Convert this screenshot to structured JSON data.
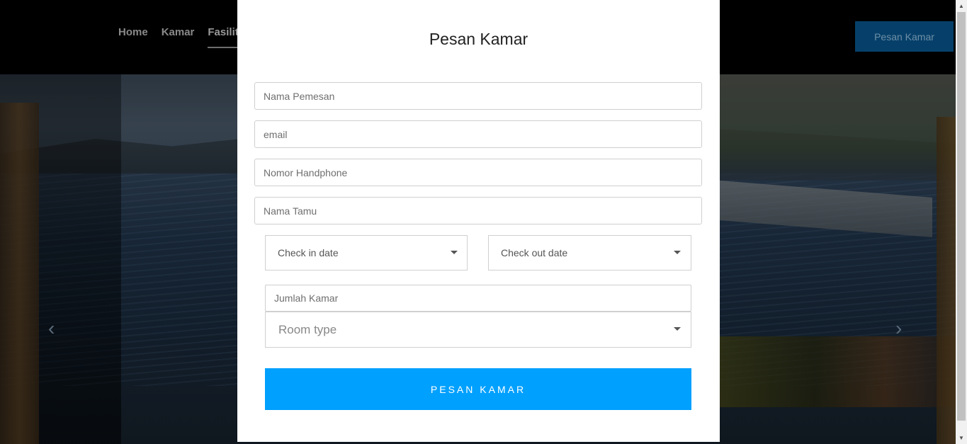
{
  "nav": {
    "links": [
      {
        "label": "Home"
      },
      {
        "label": "Kamar"
      },
      {
        "label": "Fasilit"
      }
    ],
    "cta_label": "Pesan Kamar"
  },
  "hero": {
    "prev_arrow": "‹",
    "next_arrow": "›"
  },
  "modal": {
    "title": "Pesan Kamar",
    "fields": {
      "nama_pemesan": {
        "placeholder": "Nama Pemesan",
        "value": ""
      },
      "email": {
        "placeholder": "email",
        "value": ""
      },
      "nomor_handphone": {
        "placeholder": "Nomor Handphone",
        "value": ""
      },
      "nama_tamu": {
        "placeholder": "Nama Tamu",
        "value": ""
      },
      "jumlah_kamar": {
        "placeholder": "Jumlah Kamar",
        "value": ""
      }
    },
    "check_in": {
      "label": "Check in date",
      "icon": "chevron-down-icon"
    },
    "check_out": {
      "label": "Check out date",
      "icon": "chevron-down-icon"
    },
    "room_type": {
      "label": "Room type",
      "icon": "chevron-down-icon"
    },
    "submit_label": "PESAN KAMAR",
    "accent_color": "#00a0ff"
  },
  "scrollbar": {
    "up_icon": "▲",
    "down_icon": "▼"
  }
}
